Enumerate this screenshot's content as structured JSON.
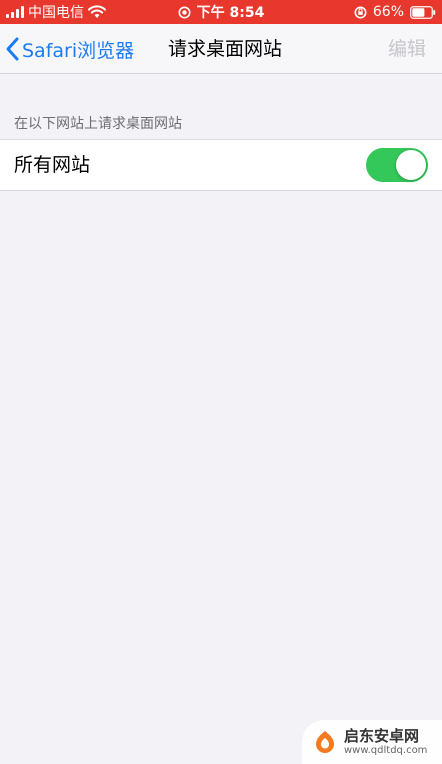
{
  "status_bar": {
    "carrier": "中国电信",
    "time": "下午 8:54",
    "battery_percent": "66%",
    "battery_level": 0.66,
    "background_color": "#e8372c"
  },
  "nav": {
    "back_label": "Safari浏览器",
    "title": "请求桌面网站",
    "edit_label": "编辑"
  },
  "section": {
    "header": "在以下网站上请求桌面网站"
  },
  "rows": [
    {
      "label": "所有网站",
      "toggle_on": true
    }
  ],
  "colors": {
    "accent": "#1a7cf5",
    "toggle_on": "#34c759",
    "background": "#f2f2f7"
  },
  "watermark": {
    "title": "启东安卓网",
    "url": "www.qdltdq.com"
  }
}
